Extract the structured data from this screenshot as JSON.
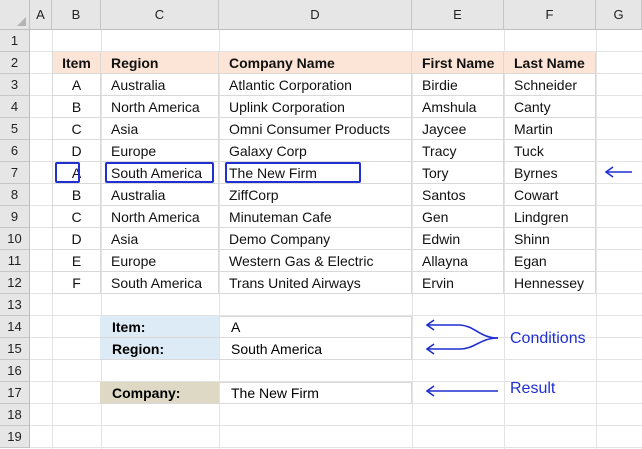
{
  "columns": [
    "A",
    "B",
    "C",
    "D",
    "E",
    "F",
    "G"
  ],
  "rows": [
    "1",
    "2",
    "3",
    "4",
    "5",
    "6",
    "7",
    "8",
    "9",
    "10",
    "11",
    "12",
    "13",
    "14",
    "15",
    "16",
    "17",
    "18",
    "19"
  ],
  "table": {
    "headers": [
      "Item",
      "Region",
      "Company Name",
      "First Name",
      "Last Name"
    ],
    "data": [
      [
        "A",
        "Australia",
        "Atlantic Corporation",
        "Birdie",
        "Schneider"
      ],
      [
        "B",
        "North America",
        "Uplink Corporation",
        "Amshula",
        "Canty"
      ],
      [
        "C",
        "Asia",
        "Omni Consumer Products",
        "Jaycee",
        "Martin"
      ],
      [
        "D",
        "Europe",
        "Galaxy Corp",
        "Tracy",
        "Tuck"
      ],
      [
        "A",
        "South America",
        "The New Firm",
        "Tory",
        "Byrnes"
      ],
      [
        "B",
        "Australia",
        "ZiffCorp",
        "Santos",
        "Cowart"
      ],
      [
        "C",
        "North America",
        "Minuteman Cafe",
        "Gen",
        "Lindgren"
      ],
      [
        "D",
        "Asia",
        "Demo Company",
        "Edwin",
        "Shinn"
      ],
      [
        "E",
        "Europe",
        "Western Gas & Electric",
        "Allayna",
        "Egan"
      ],
      [
        "F",
        "South America",
        "Trans United Airways",
        "Ervin",
        "Hennessey"
      ]
    ]
  },
  "lookup": {
    "item_label": "Item:",
    "item_value": "A",
    "region_label": "Region:",
    "region_value": "South America",
    "company_label": "Company:",
    "company_value": "The New Firm"
  },
  "annotations": {
    "conditions": "Conditions",
    "result": "Result"
  },
  "colors": {
    "header_fill": "#fce4d6",
    "criteria_fill": "#ddebf7",
    "result_fill": "#ddd9c4",
    "accent": "#1f2fd0"
  }
}
